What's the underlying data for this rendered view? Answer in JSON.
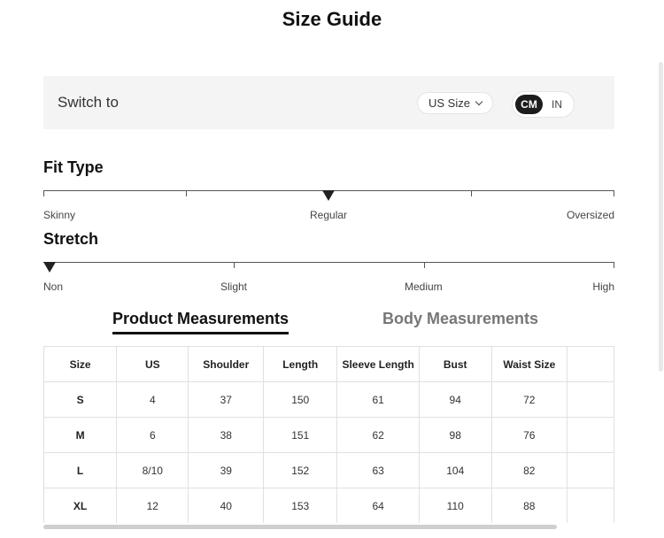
{
  "header": {
    "title": "Size Guide"
  },
  "switch_bar": {
    "label": "Switch to",
    "size_select": "US Size",
    "unit_active": "CM",
    "unit_inactive": "IN"
  },
  "fit_type": {
    "title": "Fit Type",
    "labels": [
      "Skinny",
      "Regular",
      "Oversized"
    ],
    "selected": "Regular"
  },
  "stretch": {
    "title": "Stretch",
    "labels": [
      "Non",
      "Slight",
      "Medium",
      "High"
    ],
    "selected": "Non"
  },
  "tabs": {
    "active": "Product Measurements",
    "inactive": "Body Measurements"
  },
  "table": {
    "headers": [
      "Size",
      "US",
      "Shoulder",
      "Length",
      "Sleeve Length",
      "Bust",
      "Waist Size",
      ""
    ],
    "rows": [
      [
        "S",
        "4",
        "37",
        "150",
        "61",
        "94",
        "72",
        ""
      ],
      [
        "M",
        "6",
        "38",
        "151",
        "62",
        "98",
        "76",
        ""
      ],
      [
        "L",
        "8/10",
        "39",
        "152",
        "63",
        "104",
        "82",
        ""
      ],
      [
        "XL",
        "12",
        "40",
        "153",
        "64",
        "110",
        "88",
        ""
      ]
    ]
  }
}
